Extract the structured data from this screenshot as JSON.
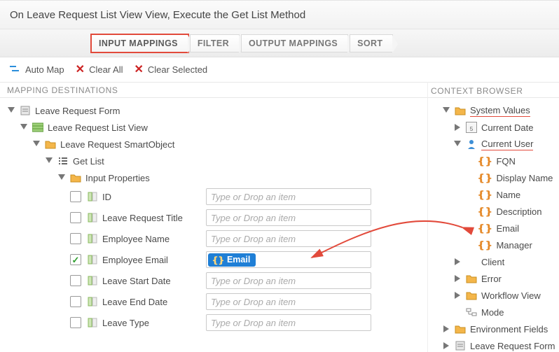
{
  "header": {
    "title": "On Leave Request List View View, Execute the Get List Method"
  },
  "tabs": {
    "input_mappings": "INPUT MAPPINGS",
    "filter": "FILTER",
    "output_mappings": "OUTPUT MAPPINGS",
    "sort": "SORT"
  },
  "toolbar": {
    "auto_map": "Auto Map",
    "clear_all": "Clear All",
    "clear_selected": "Clear Selected"
  },
  "sections": {
    "mapping_destinations": "MAPPING DESTINATIONS",
    "context_browser": "CONTEXT BROWSER"
  },
  "dest_tree": {
    "form": "Leave Request Form",
    "view": "Leave Request List View",
    "smo": "Leave Request SmartObject",
    "method": "Get List",
    "input_props": "Input Properties",
    "props": [
      {
        "name": "ID",
        "checked": false,
        "value": "",
        "placeholder": "Type or Drop an item"
      },
      {
        "name": "Leave Request Title",
        "checked": false,
        "value": "",
        "placeholder": "Type or Drop an item"
      },
      {
        "name": "Employee Name",
        "checked": false,
        "value": "",
        "placeholder": "Type or Drop an item"
      },
      {
        "name": "Employee Email",
        "checked": true,
        "value": "Email",
        "placeholder": "Type or Drop an item"
      },
      {
        "name": "Leave Start Date",
        "checked": false,
        "value": "",
        "placeholder": "Type or Drop an item"
      },
      {
        "name": "Leave End Date",
        "checked": false,
        "value": "",
        "placeholder": "Type or Drop an item"
      },
      {
        "name": "Leave Type",
        "checked": false,
        "value": "",
        "placeholder": "Type or Drop an item"
      }
    ]
  },
  "context": {
    "system_values": "System Values",
    "current_date": "Current Date",
    "current_user": "Current User",
    "cu_items": {
      "fqn": "FQN",
      "display_name": "Display Name",
      "name": "Name",
      "description": "Description",
      "email": "Email",
      "manager": "Manager"
    },
    "client": "Client",
    "error": "Error",
    "workflow_view": "Workflow View",
    "mode": "Mode",
    "environment_fields": "Environment Fields",
    "leave_request_form": "Leave Request Form"
  }
}
